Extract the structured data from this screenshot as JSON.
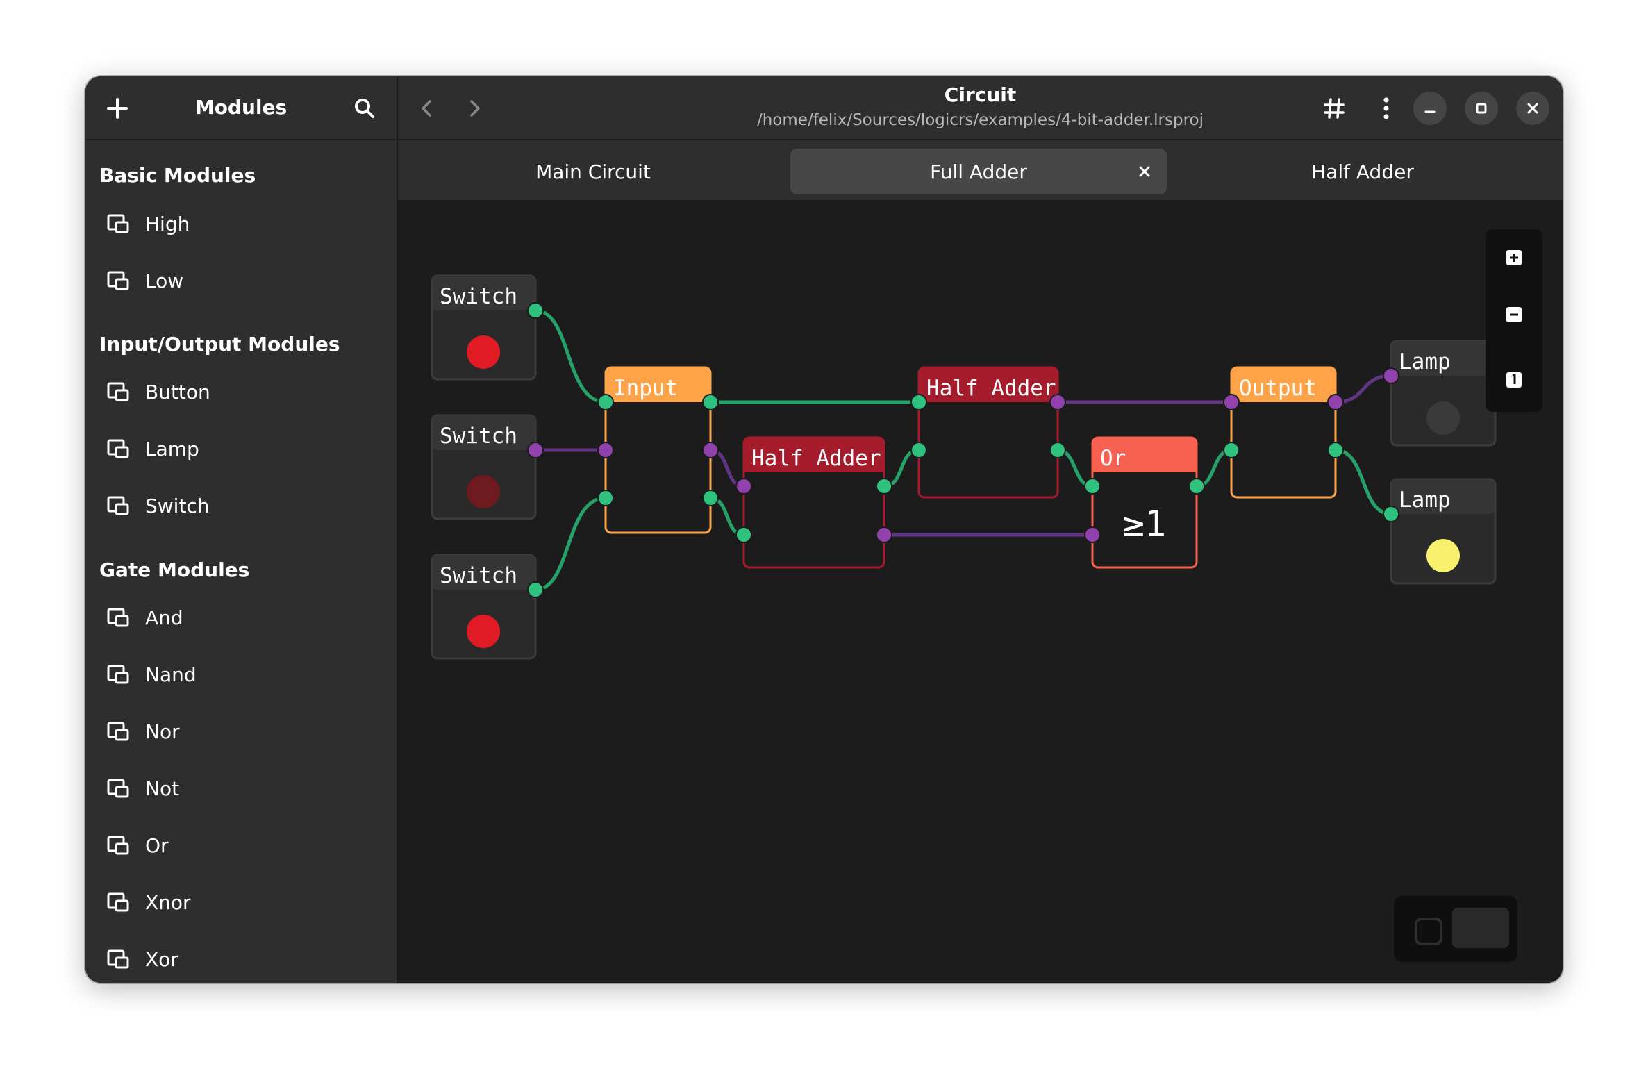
{
  "window": {
    "title": "Circuit",
    "subtitle": "/home/felix/Sources/logicrs/examples/4-bit-adder.lrsproj"
  },
  "sidebar": {
    "title": "Modules",
    "sections": [
      {
        "title": "Basic Modules",
        "items": [
          "High",
          "Low"
        ]
      },
      {
        "title": "Input/Output Modules",
        "items": [
          "Button",
          "Lamp",
          "Switch"
        ]
      },
      {
        "title": "Gate Modules",
        "items": [
          "And",
          "Nand",
          "Nor",
          "Not",
          "Or",
          "Xnor",
          "Xor"
        ]
      }
    ]
  },
  "tabs": [
    {
      "label": "Main Circuit",
      "active": false
    },
    {
      "label": "Full Adder",
      "active": true
    },
    {
      "label": "Half Adder",
      "active": false
    }
  ],
  "canvas": {
    "blocks": {
      "switch1": {
        "title": "Switch",
        "state": "on"
      },
      "switch2": {
        "title": "Switch",
        "state": "off"
      },
      "switch3": {
        "title": "Switch",
        "state": "on"
      },
      "input": {
        "title": "Input"
      },
      "half_adder_1": {
        "title": "Half Adder"
      },
      "half_adder_2": {
        "title": "Half Adder"
      },
      "or": {
        "title": "Or",
        "symbol": "≥1"
      },
      "output": {
        "title": "Output"
      },
      "lamp1": {
        "title": "Lamp",
        "state": "off"
      },
      "lamp2": {
        "title": "Lamp",
        "state": "on"
      }
    },
    "zoom_controls": {
      "zoom_in": "+",
      "zoom_out": "−",
      "reset": "1"
    }
  },
  "colors": {
    "active_wire": "#2ec27e",
    "inactive_wire": "#813d9c",
    "io_block": "#ffa348",
    "custom_block": "#a51d2d",
    "gate_block": "#f66151",
    "switch_on": "#e01b24",
    "switch_off": "#6e1a1e",
    "lamp_on": "#f9f06b",
    "lamp_off": "#3a3a3a"
  }
}
